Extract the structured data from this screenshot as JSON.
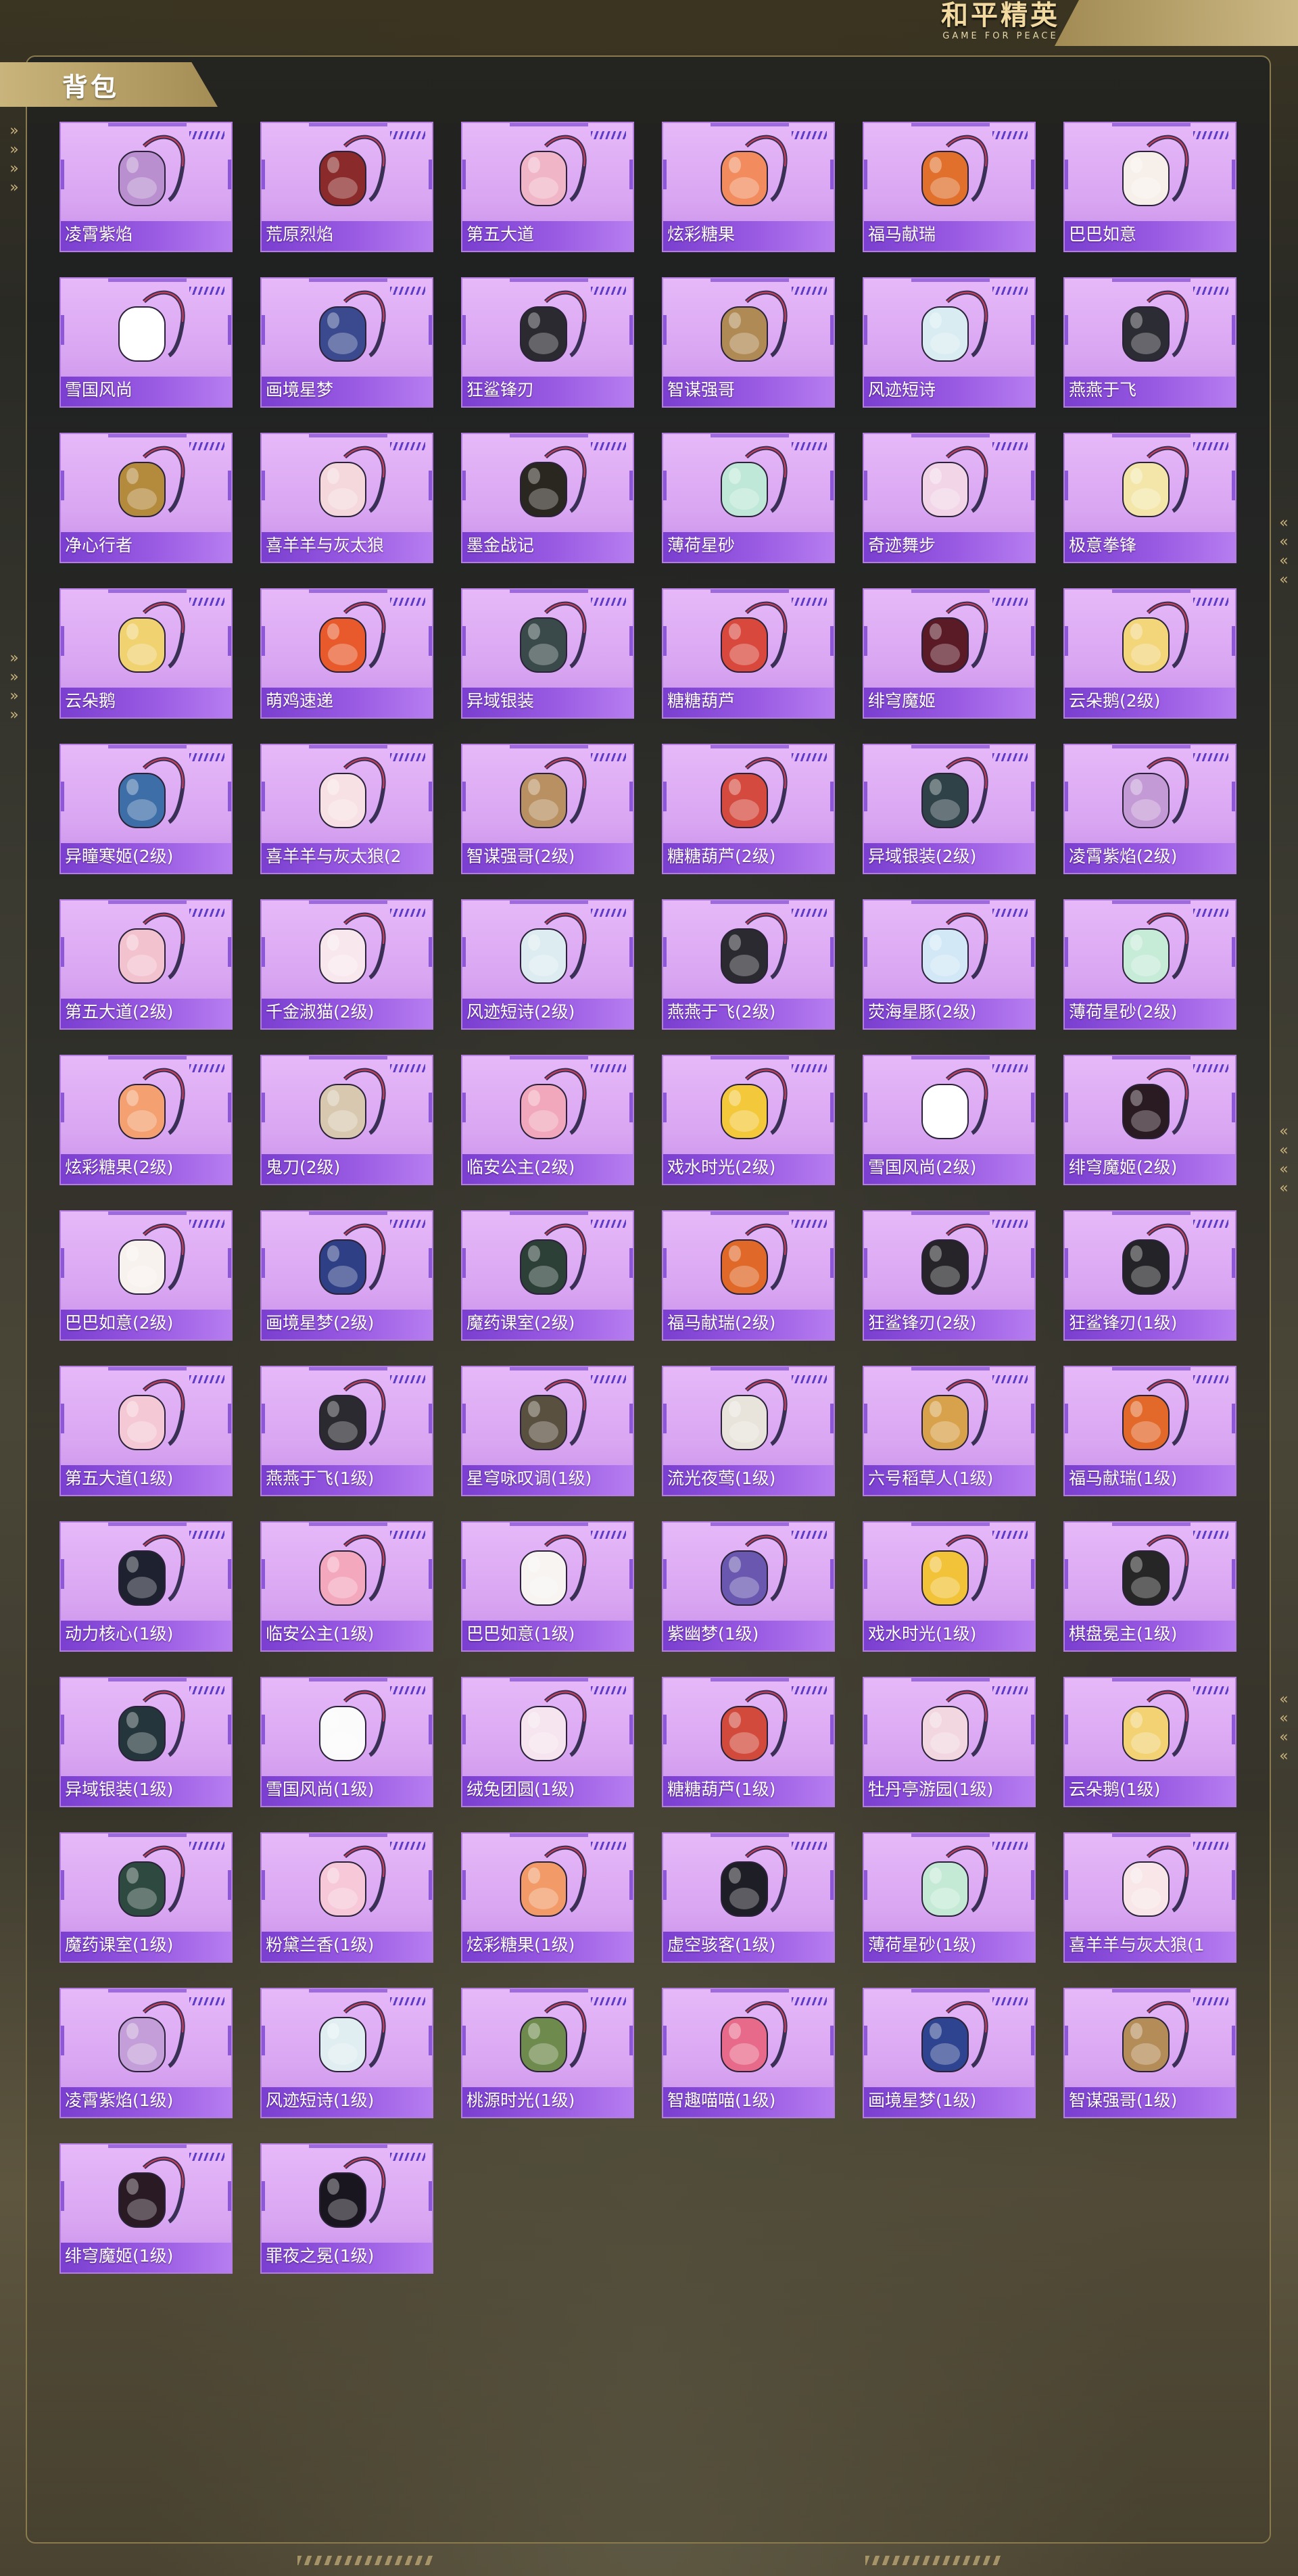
{
  "app": {
    "logo_title": "和平精英",
    "logo_subtitle": "GAME FOR PEACE"
  },
  "section": {
    "title": "背包"
  },
  "colors": {
    "card_bg": "#DDA9F4",
    "card_border": "#B47EE0",
    "name_bar": "#8A4CDB",
    "header_gold": "#C9B47C"
  },
  "items": [
    {
      "label": "凌霄紫焰",
      "color": "#b98fd0"
    },
    {
      "label": "荒原烈焰",
      "color": "#8b2a2a"
    },
    {
      "label": "第五大道",
      "color": "#f0b6c8"
    },
    {
      "label": "炫彩糖果",
      "color": "#f28c5e"
    },
    {
      "label": "福马献瑞",
      "color": "#e0702c"
    },
    {
      "label": "巴巴如意",
      "color": "#f7f0ea"
    },
    {
      "label": "雪国风尚",
      "color": "#ffffff"
    },
    {
      "label": "画境星梦",
      "color": "#3b4a8f"
    },
    {
      "label": "狂鲨锋刃",
      "color": "#2a2a30"
    },
    {
      "label": "智谋强哥",
      "color": "#b08a55"
    },
    {
      "label": "风迹短诗",
      "color": "#d8ecf2"
    },
    {
      "label": "燕燕于飞",
      "color": "#2c2c34"
    },
    {
      "label": "净心行者",
      "color": "#b48a3c"
    },
    {
      "label": "喜羊羊与灰太狼",
      "color": "#f4d8dc"
    },
    {
      "label": "墨金战记",
      "color": "#2a2620"
    },
    {
      "label": "薄荷星砂",
      "color": "#bfe8d8"
    },
    {
      "label": "奇迹舞步",
      "color": "#f2d6e8"
    },
    {
      "label": "极意拳锋",
      "color": "#f3e6a8"
    },
    {
      "label": "云朵鹅",
      "color": "#f0d270"
    },
    {
      "label": "萌鸡速递",
      "color": "#e85a2c"
    },
    {
      "label": "异域银装",
      "color": "#3a4a4a"
    },
    {
      "label": "糖糖葫芦",
      "color": "#d8483c"
    },
    {
      "label": "绯穹魔姬",
      "color": "#5a1a26"
    },
    {
      "label": "云朵鹅(2级)",
      "color": "#f3d57a"
    },
    {
      "label": "异瞳寒姬(2级)",
      "color": "#3e6ea8"
    },
    {
      "label": "喜羊羊与灰太狼(2",
      "color": "#f7e1e4"
    },
    {
      "label": "智谋强哥(2级)",
      "color": "#b89062"
    },
    {
      "label": "糖糖葫芦(2级)",
      "color": "#d44a3e"
    },
    {
      "label": "异域银装(2级)",
      "color": "#2f4248"
    },
    {
      "label": "凌霄紫焰(2级)",
      "color": "#c49ad6"
    },
    {
      "label": "第五大道(2级)",
      "color": "#f3c2cf"
    },
    {
      "label": "千金淑猫(2级)",
      "color": "#f8e8ee"
    },
    {
      "label": "风迹短诗(2级)",
      "color": "#dcecf0"
    },
    {
      "label": "燕燕于飞(2级)",
      "color": "#2a2a30"
    },
    {
      "label": "荧海星豚(2级)",
      "color": "#d2e8f6"
    },
    {
      "label": "薄荷星砂(2级)",
      "color": "#c6ecd8"
    },
    {
      "label": "炫彩糖果(2级)",
      "color": "#f4a070"
    },
    {
      "label": "鬼刀(2级)",
      "color": "#d8c8b0"
    },
    {
      "label": "临安公主(2级)",
      "color": "#f2a8bc"
    },
    {
      "label": "戏水时光(2级)",
      "color": "#f3c83a"
    },
    {
      "label": "雪国风尚(2级)",
      "color": "#ffffff"
    },
    {
      "label": "绯穹魔姬(2级)",
      "color": "#2a1a22"
    },
    {
      "label": "巴巴如意(2级)",
      "color": "#f8f2ee"
    },
    {
      "label": "画境星梦(2级)",
      "color": "#2e3f86"
    },
    {
      "label": "魔药课室(2级)",
      "color": "#2c4038"
    },
    {
      "label": "福马献瑞(2级)",
      "color": "#e06828"
    },
    {
      "label": "狂鲨锋刃(2级)",
      "color": "#262428"
    },
    {
      "label": "狂鲨锋刃(1级)",
      "color": "#242428"
    },
    {
      "label": "第五大道(1级)",
      "color": "#f4c8d4"
    },
    {
      "label": "燕燕于飞(1级)",
      "color": "#2a2a30"
    },
    {
      "label": "星穹咏叹调(1级)",
      "color": "#5a5040"
    },
    {
      "label": "流光夜莺(1级)",
      "color": "#e8e4dc"
    },
    {
      "label": "六号稻草人(1级)",
      "color": "#d8a24c"
    },
    {
      "label": "福马献瑞(1级)",
      "color": "#e2692a"
    },
    {
      "label": "动力核心(1级)",
      "color": "#1e2230"
    },
    {
      "label": "临安公主(1级)",
      "color": "#f4a8be"
    },
    {
      "label": "巴巴如意(1级)",
      "color": "#f7f4f2"
    },
    {
      "label": "紫幽梦(1级)",
      "color": "#6a58b0"
    },
    {
      "label": "戏水时光(1级)",
      "color": "#f2c238"
    },
    {
      "label": "棋盘冕主(1级)",
      "color": "#262626"
    },
    {
      "label": "异域银装(1级)",
      "color": "#24363c"
    },
    {
      "label": "雪国风尚(1级)",
      "color": "#fbfbfb"
    },
    {
      "label": "绒兔团圆(1级)",
      "color": "#f6e4ee"
    },
    {
      "label": "糖糖葫芦(1级)",
      "color": "#d24a3c"
    },
    {
      "label": "牡丹亭游园(1级)",
      "color": "#f2d6e0"
    },
    {
      "label": "云朵鹅(1级)",
      "color": "#f2d272"
    },
    {
      "label": "魔药课室(1级)",
      "color": "#2e4a40"
    },
    {
      "label": "粉黛兰香(1级)",
      "color": "#f6c8d8"
    },
    {
      "label": "炫彩糖果(1级)",
      "color": "#f29a68"
    },
    {
      "label": "虚空骇客(1级)",
      "color": "#1e1e26"
    },
    {
      "label": "薄荷星砂(1级)",
      "color": "#c4ead6"
    },
    {
      "label": "喜羊羊与灰太狼(1",
      "color": "#f8e6e8"
    },
    {
      "label": "凌霄紫焰(1级)",
      "color": "#c49ed8"
    },
    {
      "label": "风迹短诗(1级)",
      "color": "#e0eef2"
    },
    {
      "label": "桃源时光(1级)",
      "color": "#6e8a4c"
    },
    {
      "label": "智趣喵喵(1级)",
      "color": "#e86a8a"
    },
    {
      "label": "画境星梦(1级)",
      "color": "#2e4490"
    },
    {
      "label": "智谋强哥(1级)",
      "color": "#b48c58"
    },
    {
      "label": "绯穹魔姬(1级)",
      "color": "#2a1a24"
    },
    {
      "label": "罪夜之冕(1级)",
      "color": "#1a1620"
    }
  ]
}
